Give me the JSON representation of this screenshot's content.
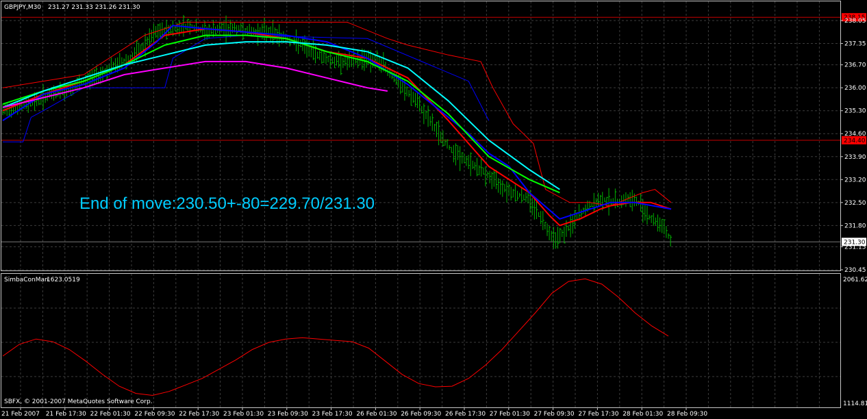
{
  "header": {
    "symbol": "GBPJPY,M30",
    "ohlc": "231.27 231.33 231.26 231.30"
  },
  "indicator": {
    "name": "SimbaConMan",
    "value": "1623.0519"
  },
  "copyright": "SBFX, © 2001-2007 MetaQuotes Software Corp.",
  "annotation": "End of move:230.50+-80=229.70/231.30",
  "colors": {
    "background": "#000000",
    "grid": "#3c3c3c",
    "bars": "#00b400",
    "ma_red": "#ff0000",
    "ma_blue": "#0000ff",
    "ma_green": "#00ff00",
    "ma_cyan": "#00ffff",
    "ma_magenta": "#ff00ff",
    "channel": "#ff0000",
    "annotation": "#00ccff",
    "level_line": "#c80000",
    "oscillator": "#ff0000"
  },
  "chart_data": [
    {
      "type": "line",
      "title": "GBPJPY,M30",
      "x_ticks": [
        "21 Feb 2007",
        "21 Feb 17:30",
        "22 Feb 01:30",
        "22 Feb 09:30",
        "22 Feb 17:30",
        "23 Feb 01:30",
        "23 Feb 09:30",
        "23 Feb 17:30",
        "26 Feb 01:30",
        "26 Feb 09:30",
        "26 Feb 17:30",
        "27 Feb 01:30",
        "27 Feb 09:30",
        "27 Feb 17:30",
        "28 Feb 01:30",
        "28 Feb 09:30"
      ],
      "y_ticks": [
        "238.05",
        "237.35",
        "236.70",
        "236.00",
        "235.30",
        "234.60",
        "233.90",
        "233.20",
        "232.50",
        "231.80",
        "231.15",
        "230.45"
      ],
      "ylim": [
        230.45,
        238.05
      ],
      "price_labels": {
        "upper_level": "238.15",
        "lower_level": "234.40",
        "current_price": "231.30"
      },
      "horizontal_levels": [
        238.15,
        234.4,
        231.3
      ],
      "price_path": [
        [
          0,
          235.3
        ],
        [
          8,
          235.4
        ],
        [
          16,
          235.6
        ],
        [
          24,
          235.8
        ],
        [
          32,
          235.9
        ],
        [
          40,
          236.2
        ],
        [
          48,
          236.4
        ],
        [
          56,
          236.7
        ],
        [
          64,
          236.9
        ],
        [
          70,
          237.3
        ],
        [
          76,
          237.7
        ],
        [
          84,
          237.8
        ],
        [
          92,
          237.9
        ],
        [
          100,
          237.7
        ],
        [
          108,
          237.8
        ],
        [
          116,
          237.8
        ],
        [
          124,
          237.7
        ],
        [
          132,
          237.7
        ],
        [
          140,
          237.5
        ],
        [
          148,
          237.3
        ],
        [
          156,
          237.0
        ],
        [
          164,
          236.8
        ],
        [
          172,
          236.8
        ],
        [
          180,
          236.9
        ],
        [
          188,
          236.7
        ],
        [
          196,
          236.1
        ],
        [
          204,
          235.6
        ],
        [
          212,
          234.9
        ],
        [
          220,
          234.2
        ],
        [
          228,
          233.8
        ],
        [
          236,
          233.5
        ],
        [
          244,
          233.1
        ],
        [
          252,
          232.8
        ],
        [
          260,
          232.6
        ],
        [
          266,
          232.0
        ],
        [
          272,
          231.4
        ],
        [
          278,
          231.6
        ],
        [
          284,
          232.1
        ],
        [
          290,
          232.4
        ],
        [
          296,
          232.6
        ],
        [
          302,
          232.5
        ],
        [
          308,
          232.6
        ],
        [
          314,
          232.5
        ],
        [
          320,
          232.0
        ],
        [
          326,
          231.8
        ],
        [
          330,
          231.3
        ]
      ],
      "series": [
        {
          "name": "ma_red",
          "color": "#ff0000",
          "points": [
            [
              0,
              235.3
            ],
            [
              20,
              235.8
            ],
            [
              40,
              236.2
            ],
            [
              60,
              236.7
            ],
            [
              80,
              237.6
            ],
            [
              100,
              237.8
            ],
            [
              120,
              237.7
            ],
            [
              140,
              237.5
            ],
            [
              160,
              237.1
            ],
            [
              180,
              236.9
            ],
            [
              200,
              236.3
            ],
            [
              220,
              235.0
            ],
            [
              240,
              233.6
            ],
            [
              260,
              232.8
            ],
            [
              270,
              232.1
            ],
            [
              275,
              231.8
            ],
            [
              285,
              232.0
            ],
            [
              295,
              232.3
            ],
            [
              300,
              232.4
            ],
            [
              310,
              232.5
            ],
            [
              320,
              232.5
            ],
            [
              330,
              232.3
            ]
          ]
        },
        {
          "name": "ma_blue",
          "color": "#0000ff",
          "points": [
            [
              0,
              235.0
            ],
            [
              20,
              235.8
            ],
            [
              40,
              236.1
            ],
            [
              60,
              236.6
            ],
            [
              76,
              237.4
            ],
            [
              84,
              237.9
            ],
            [
              100,
              237.8
            ],
            [
              120,
              237.7
            ],
            [
              140,
              237.6
            ],
            [
              160,
              237.4
            ],
            [
              180,
              236.9
            ],
            [
              200,
              236.1
            ],
            [
              216,
              235.3
            ],
            [
              230,
              234.6
            ],
            [
              240,
              234.0
            ],
            [
              250,
              233.6
            ],
            [
              260,
              232.8
            ],
            [
              275,
              232.0
            ],
            [
              285,
              232.2
            ],
            [
              300,
              232.5
            ],
            [
              312,
              232.5
            ],
            [
              330,
              232.3
            ]
          ]
        },
        {
          "name": "ma_green",
          "color": "#00ff00",
          "points": [
            [
              0,
              235.5
            ],
            [
              20,
              235.9
            ],
            [
              40,
              236.2
            ],
            [
              60,
              236.7
            ],
            [
              80,
              237.3
            ],
            [
              100,
              237.6
            ],
            [
              120,
              237.6
            ],
            [
              140,
              237.5
            ],
            [
              160,
              237.1
            ],
            [
              180,
              236.8
            ],
            [
              200,
              236.2
            ],
            [
              220,
              235.2
            ],
            [
              240,
              233.9
            ],
            [
              260,
              233.2
            ],
            [
              275,
              232.8
            ]
          ]
        },
        {
          "name": "ma_cyan",
          "color": "#00ffff",
          "points": [
            [
              0,
              235.4
            ],
            [
              20,
              235.9
            ],
            [
              40,
              236.3
            ],
            [
              60,
              236.7
            ],
            [
              80,
              237.0
            ],
            [
              100,
              237.3
            ],
            [
              120,
              237.4
            ],
            [
              140,
              237.4
            ],
            [
              160,
              237.3
            ],
            [
              180,
              237.1
            ],
            [
              200,
              236.6
            ],
            [
              220,
              235.6
            ],
            [
              240,
              234.4
            ],
            [
              260,
              233.5
            ],
            [
              275,
              232.9
            ]
          ]
        },
        {
          "name": "ma_magenta",
          "color": "#ff00ff",
          "points": [
            [
              0,
              235.4
            ],
            [
              20,
              235.7
            ],
            [
              40,
              236.0
            ],
            [
              60,
              236.4
            ],
            [
              80,
              236.6
            ],
            [
              100,
              236.8
            ],
            [
              120,
              236.8
            ],
            [
              140,
              236.6
            ],
            [
              160,
              236.3
            ],
            [
              180,
              236.0
            ],
            [
              190,
              235.9
            ]
          ]
        }
      ]
    },
    {
      "type": "line",
      "title": "SimbaConMan 1623.0519",
      "y_ticks": [
        "2061.6249",
        "1114.8194"
      ],
      "ylim": [
        1114.8194,
        2061.6249
      ],
      "values": [
        [
          0,
          1470
        ],
        [
          10,
          1560
        ],
        [
          20,
          1600
        ],
        [
          30,
          1580
        ],
        [
          40,
          1520
        ],
        [
          50,
          1430
        ],
        [
          60,
          1330
        ],
        [
          70,
          1240
        ],
        [
          80,
          1185
        ],
        [
          90,
          1170
        ],
        [
          100,
          1200
        ],
        [
          110,
          1250
        ],
        [
          120,
          1300
        ],
        [
          130,
          1370
        ],
        [
          140,
          1440
        ],
        [
          150,
          1520
        ],
        [
          160,
          1575
        ],
        [
          170,
          1600
        ],
        [
          180,
          1610
        ],
        [
          190,
          1600
        ],
        [
          200,
          1590
        ],
        [
          210,
          1580
        ],
        [
          220,
          1530
        ],
        [
          230,
          1430
        ],
        [
          240,
          1330
        ],
        [
          250,
          1260
        ],
        [
          260,
          1235
        ],
        [
          270,
          1240
        ],
        [
          280,
          1300
        ],
        [
          290,
          1400
        ],
        [
          300,
          1520
        ],
        [
          310,
          1660
        ],
        [
          320,
          1800
        ],
        [
          330,
          1950
        ],
        [
          340,
          2040
        ],
        [
          350,
          2060
        ],
        [
          360,
          2020
        ],
        [
          370,
          1920
        ],
        [
          380,
          1800
        ],
        [
          390,
          1700
        ],
        [
          400,
          1623
        ]
      ]
    }
  ]
}
